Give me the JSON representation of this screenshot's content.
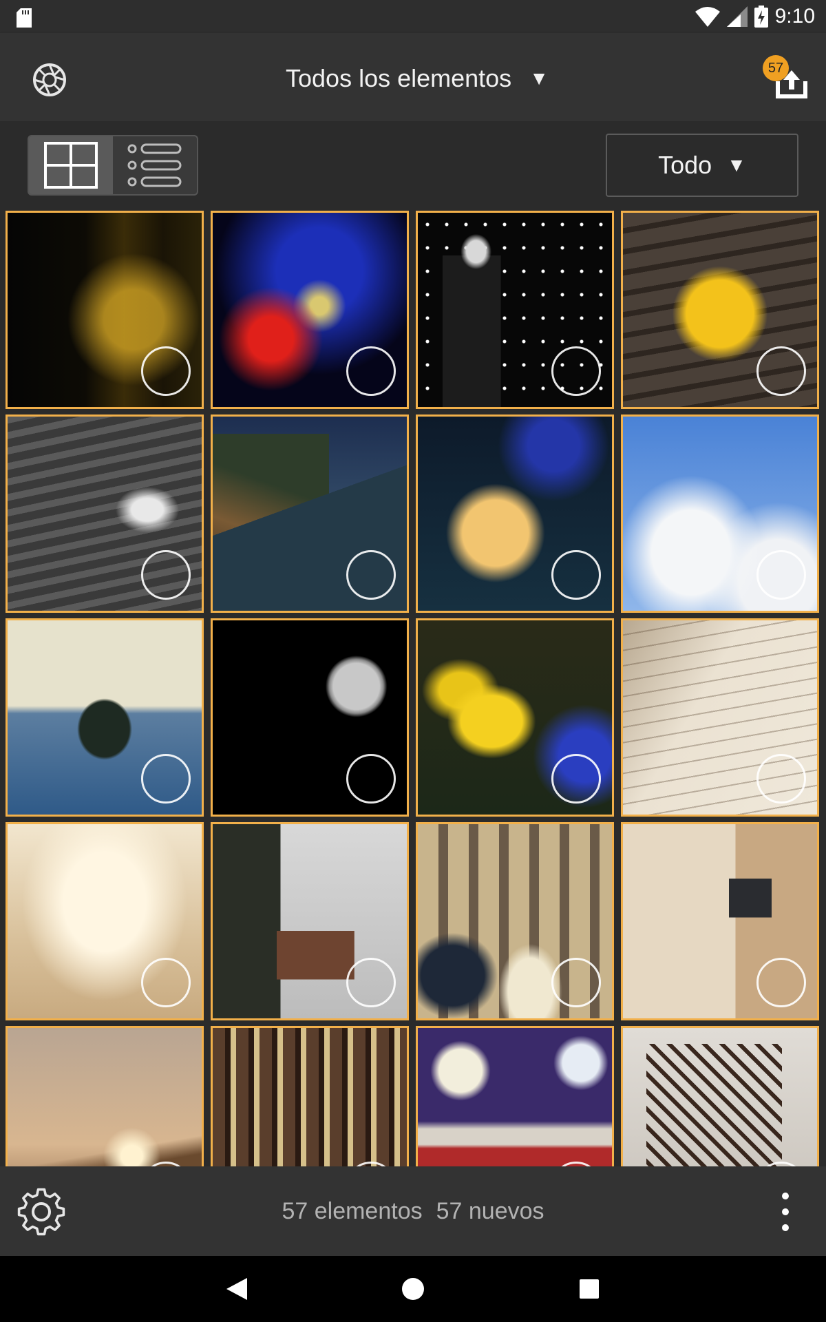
{
  "status_bar": {
    "time": "9:10"
  },
  "app_bar": {
    "title": "Todos los elementos",
    "dropdown_caret": "▼",
    "transfer_badge": "57",
    "icons": [
      "camera-shutter-icon",
      "upload-transfer-icon"
    ]
  },
  "toolbar": {
    "views": [
      "grid-view-icon",
      "list-view-icon"
    ],
    "active_view": "grid",
    "filter_label": "Todo",
    "filter_caret": "▼"
  },
  "grid": {
    "accent": "#f2b04a",
    "items": [
      {
        "subject": "bottles-bokeh"
      },
      {
        "subject": "light-painting"
      },
      {
        "subject": "mannequin"
      },
      {
        "subject": "maple-leaf"
      },
      {
        "subject": "seagull-waves"
      },
      {
        "subject": "coastline"
      },
      {
        "subject": "yellow-tulip-blue"
      },
      {
        "subject": "bird-sky"
      },
      {
        "subject": "island"
      },
      {
        "subject": "moon"
      },
      {
        "subject": "yellow-tulips"
      },
      {
        "subject": "open-book"
      },
      {
        "subject": "bright-hall"
      },
      {
        "subject": "snowy-cabin"
      },
      {
        "subject": "vintage-cars-street"
      },
      {
        "subject": "interior-wall"
      },
      {
        "subject": "misty-sunset"
      },
      {
        "subject": "building-facade"
      },
      {
        "subject": "painted-face"
      },
      {
        "subject": "cake-fork"
      }
    ]
  },
  "bottom_bar": {
    "items_count": "57 elementos",
    "new_count": "57 nuevos"
  },
  "colors": {
    "background": "#2b2b2b",
    "bar": "#333333",
    "badge": "#f0a022"
  }
}
